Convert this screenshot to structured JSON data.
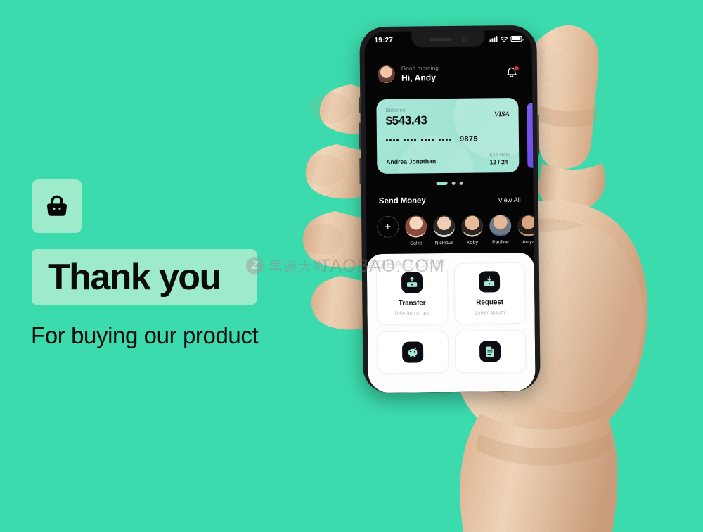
{
  "page": {
    "background_color": "#3cdbad",
    "accent_mint": "#9debcb",
    "card_mint": "#a9e7d8",
    "dark": "#050506"
  },
  "promo": {
    "bag_icon": "shopping-bag-icon",
    "headline": "Thank you",
    "subtitle": "For buying our product"
  },
  "watermarks": {
    "brand_mark": "Z",
    "brand_cn": "早道大咖",
    "taobao": "TAOBAO.COM"
  },
  "phone": {
    "status_bar": {
      "time": "19:27",
      "signal": "signal-bars-icon",
      "wifi": "wifi-icon",
      "battery": "battery-full-icon"
    },
    "header": {
      "greeting": "Good morning",
      "name": "Hi, Andy",
      "avatar": "user-avatar",
      "notification": "bell-icon",
      "has_badge": true
    },
    "card": {
      "balance_label": "Balance",
      "balance_amount": "$543.43",
      "network": "VISA",
      "masked_number": "**** **** **** ****",
      "last4": "9875",
      "holder": "Andrea Jonathan",
      "exp_label": "Exp Date",
      "exp_value": "12 / 24",
      "carousel_total": 3,
      "carousel_active": 1
    },
    "send_money": {
      "title": "Send Money",
      "view_all": "View All",
      "add_label": "+",
      "contacts": [
        {
          "name": "Sallie"
        },
        {
          "name": "Nicklaus"
        },
        {
          "name": "Koby"
        },
        {
          "name": "Pauline"
        },
        {
          "name": "Aniya"
        }
      ]
    },
    "actions": [
      {
        "title": "Transfer",
        "subtitle": "Take acc to acc",
        "icon": "transfer-up-icon"
      },
      {
        "title": "Request",
        "subtitle": "Lorem ipsum",
        "icon": "request-down-icon"
      },
      {
        "title": "",
        "subtitle": "",
        "icon": "savings-icon"
      },
      {
        "title": "",
        "subtitle": "",
        "icon": "bill-document-icon"
      }
    ]
  }
}
